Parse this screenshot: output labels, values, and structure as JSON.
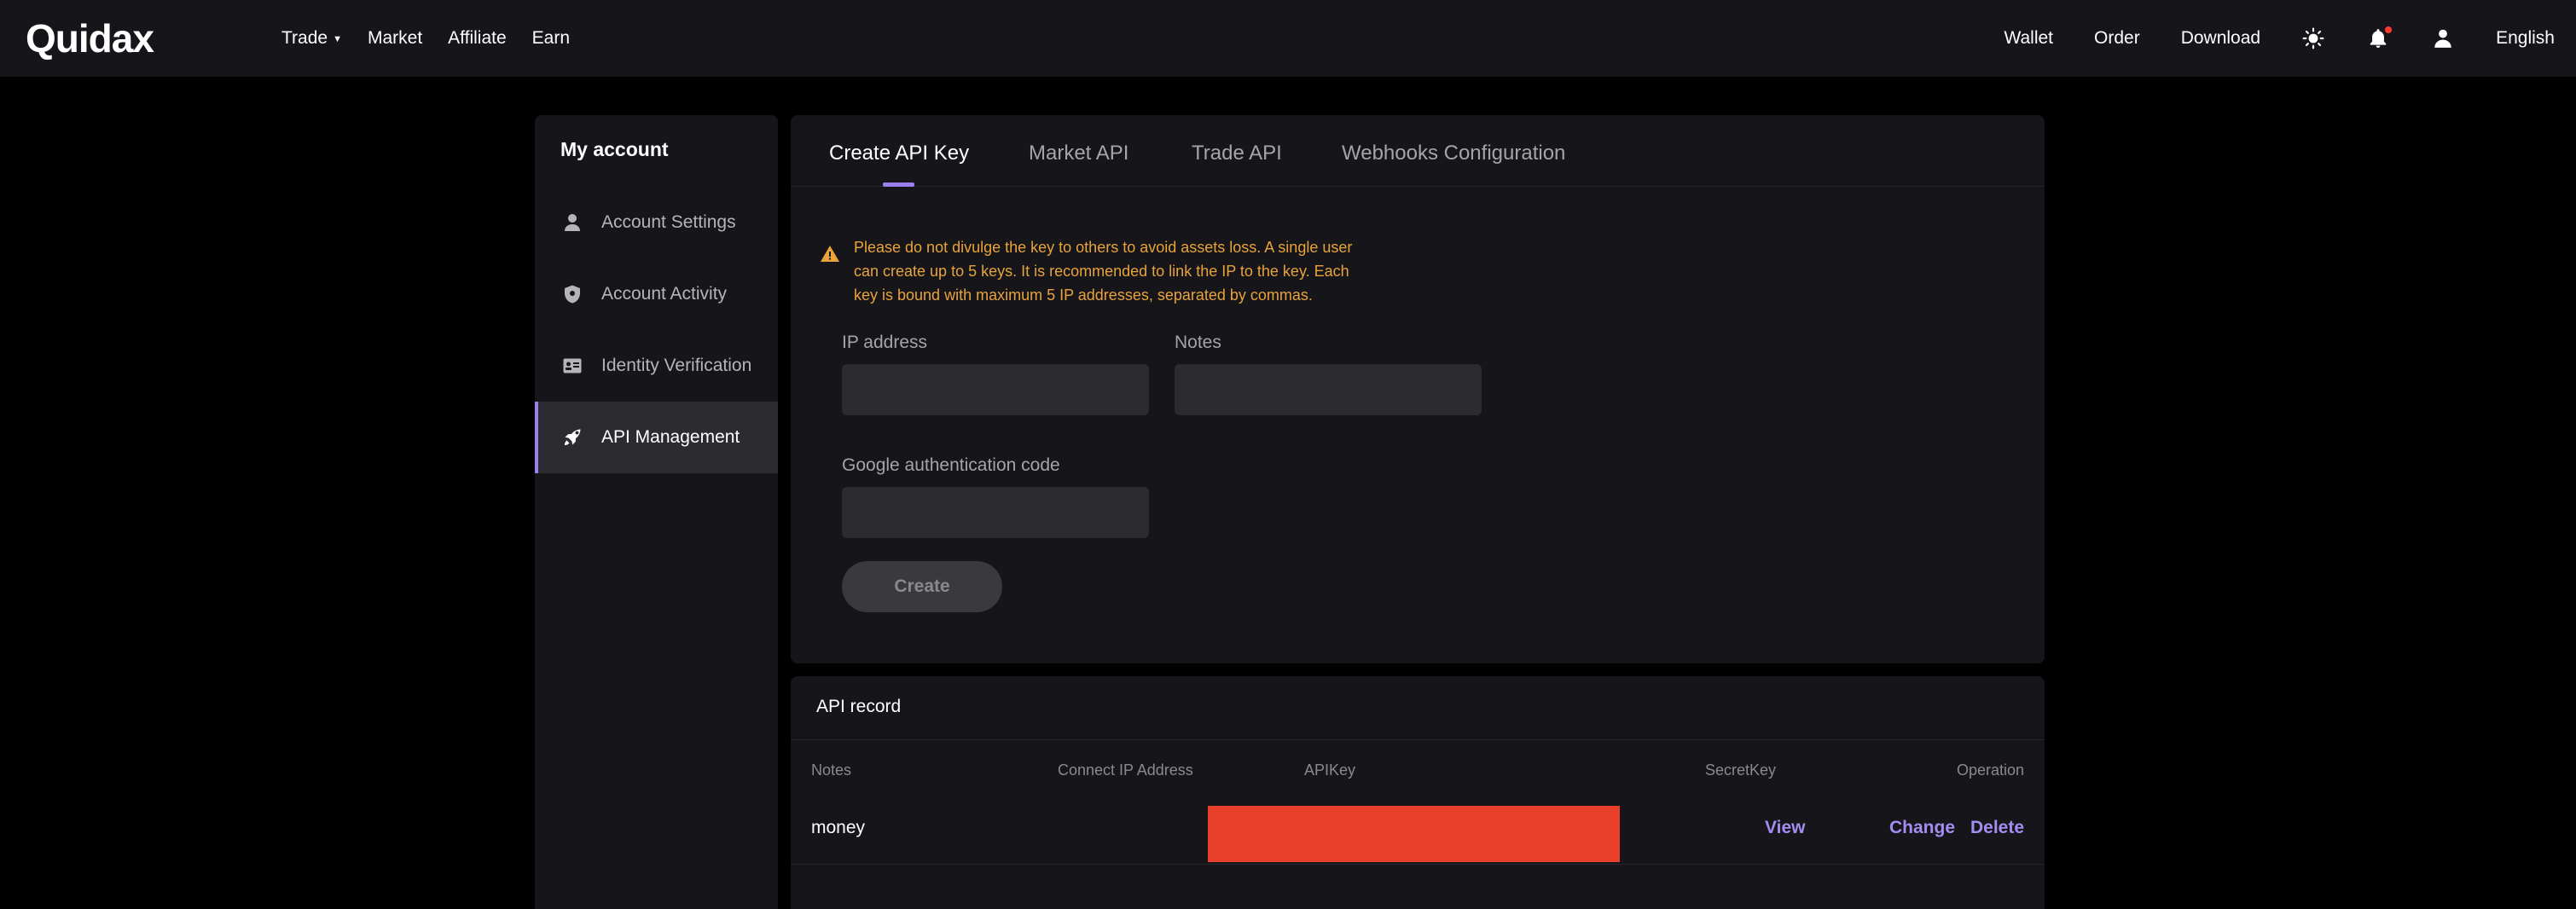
{
  "nav": {
    "logo": "Quidax",
    "left_items": [
      {
        "label": "Trade"
      },
      {
        "label": "Market"
      },
      {
        "label": "Affiliate"
      },
      {
        "label": "Earn"
      }
    ],
    "right_items": {
      "wallet": "Wallet",
      "order": "Order",
      "download": "Download",
      "language": "English"
    },
    "icons": [
      "sun-icon",
      "bell-icon",
      "user-icon"
    ]
  },
  "sidebar": {
    "title": "My account",
    "items": [
      {
        "label": "Account Settings",
        "icon": "person-icon"
      },
      {
        "label": "Account Activity",
        "icon": "shield-icon"
      },
      {
        "label": "Identity Verification",
        "icon": "id-card-icon"
      },
      {
        "label": "API Management",
        "icon": "rocket-icon",
        "active": true
      }
    ]
  },
  "tabs": [
    {
      "label": "Create API Key",
      "active": true
    },
    {
      "label": "Market API"
    },
    {
      "label": "Trade API"
    },
    {
      "label": "Webhooks Configuration"
    }
  ],
  "form": {
    "warning_lines": [
      "Please do not divulge the key to others to avoid assets loss. A single user",
      "can create up to 5 keys. It is recommended to link the IP to the key. Each",
      "key is bound with maximum 5 IP addresses, separated by commas."
    ],
    "ip_label": "IP address",
    "ip_value": "",
    "notes_label": "Notes",
    "notes_value": "",
    "google_label": "Google authentication code",
    "google_value": "",
    "create_label": "Create"
  },
  "record": {
    "title": "API record",
    "columns": [
      "Notes",
      "Connect IP Address",
      "APIKey",
      "SecretKey",
      "Operation"
    ],
    "rows": [
      {
        "notes": "money",
        "ip": "",
        "view": "View",
        "change": "Change",
        "delete": "Delete"
      }
    ]
  },
  "colors": {
    "accent": "#9b7ff0",
    "link": "#a48df0",
    "warning": "#e8a33c",
    "redaction": "#e8402b",
    "notification_dot": "#ff3b30"
  }
}
